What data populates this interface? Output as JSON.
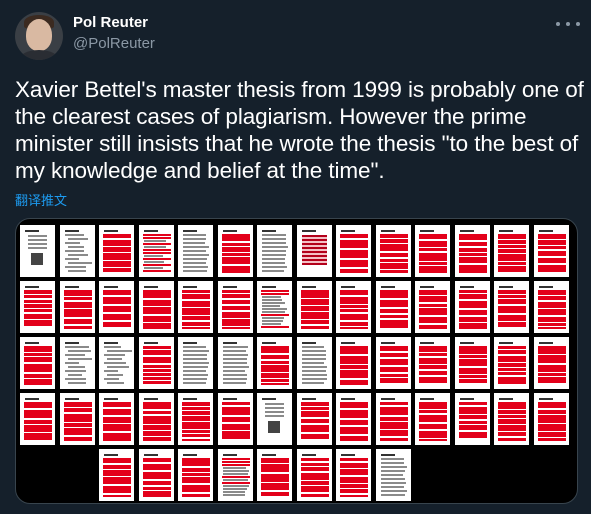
{
  "author": {
    "name": "Pol Reuter",
    "handle": "@PolReuter"
  },
  "tweet": {
    "text": "Xavier Bettel's master thesis from 1999 is probably one of the clearest cases of plagiarism. However the prime minister still insists that he wrote the thesis \"to the best of my knowledge and belief at the time\".",
    "translate_label": "翻译推文"
  },
  "icons": {
    "more": "more-dots-icon"
  },
  "colors": {
    "background": "#15202b",
    "secondary_text": "#8b98a5",
    "link": "#1d9bf0",
    "highlight": "#e3001a"
  },
  "media": {
    "type": "grid of thesis pages with plagiarized passages highlighted in red",
    "rows": [
      [
        "title",
        "list",
        "red",
        "mixed",
        "text",
        "red",
        "text",
        "table",
        "red",
        "red",
        "red",
        "red",
        "red",
        "red"
      ],
      [
        "red",
        "red",
        "red",
        "red",
        "red",
        "red",
        "mixed",
        "red",
        "red",
        "red",
        "red",
        "red",
        "red",
        "red"
      ],
      [
        "red",
        "list",
        "list",
        "red",
        "text",
        "text",
        "red",
        "text",
        "red",
        "red",
        "red",
        "red",
        "red",
        "red"
      ],
      [
        "red",
        "red",
        "red",
        "red",
        "red",
        "red",
        "title",
        "red",
        "red",
        "red",
        "red",
        "red",
        "red",
        "red"
      ],
      [
        "",
        "",
        "red",
        "red",
        "red",
        "mixed",
        "red",
        "red",
        "red",
        "text",
        "",
        "",
        "",
        ""
      ]
    ]
  }
}
